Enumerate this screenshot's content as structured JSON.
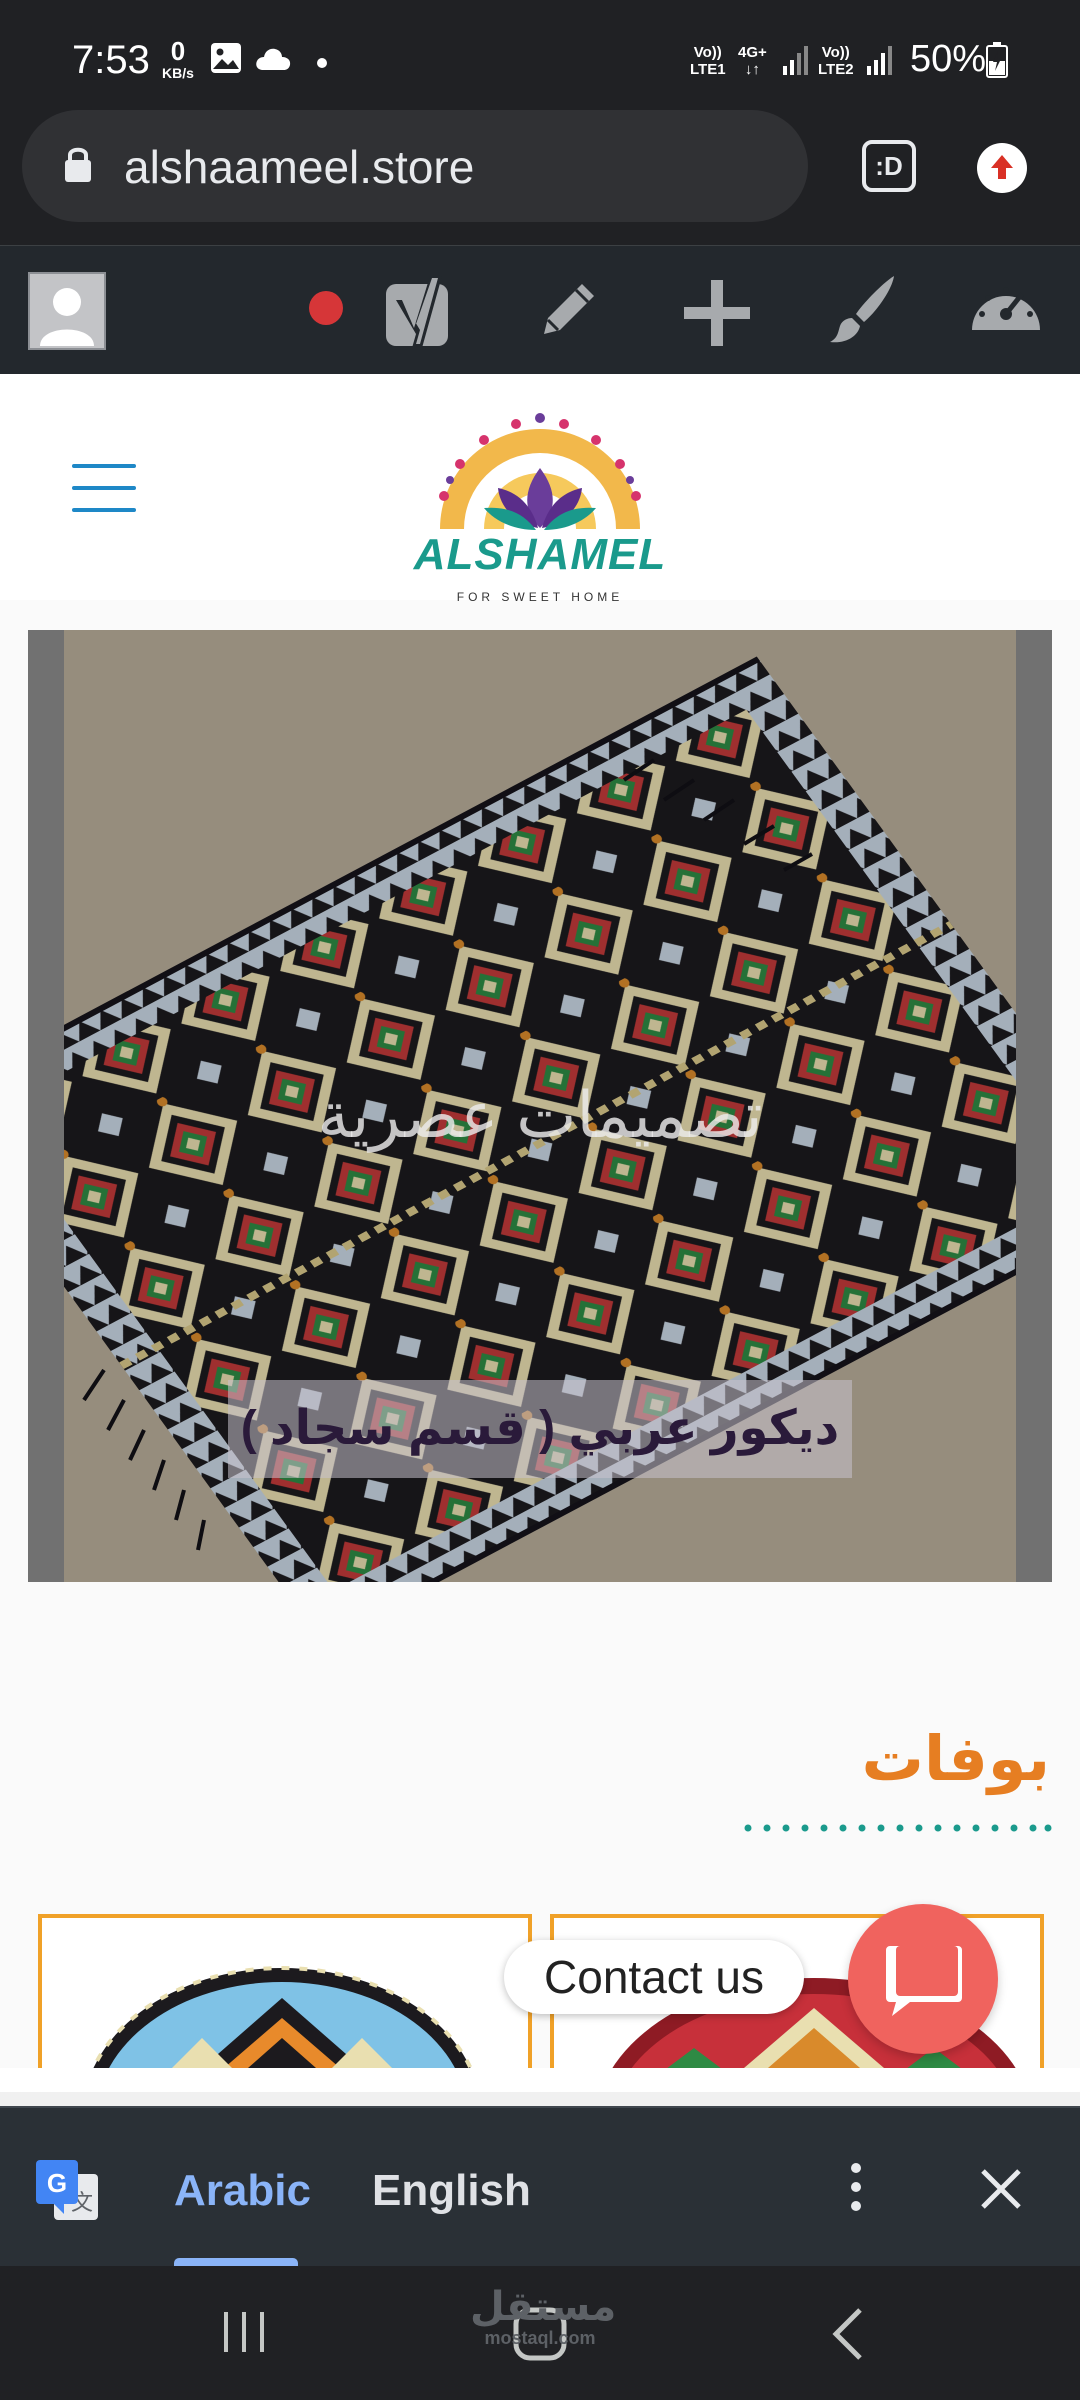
{
  "status_bar": {
    "time": "7:53",
    "net_speed_value": "0",
    "net_speed_unit": "KB/s",
    "sim1_top": "Vo))",
    "sim1_bottom": "LTE1",
    "net_type": "4G+",
    "sim2_top": "Vo))",
    "sim2_bottom": "LTE2",
    "battery": "50%",
    "icons": [
      "gallery-icon",
      "cloud-icon",
      "dot-icon",
      "signal-icon",
      "battery-icon"
    ]
  },
  "address_bar": {
    "url": "alshaameel.store",
    "tab_switcher": ":D"
  },
  "site": {
    "logo_text": "ALSHAMEL",
    "logo_subtext": "FOR SWEET HOME"
  },
  "slider": {
    "title": "تصميمات عصرية",
    "button_label": "ديكور عربي ( قسم سجاد )"
  },
  "section": {
    "title": "بوفات"
  },
  "contact": {
    "label": "Contact us"
  },
  "translate_bar": {
    "source_language": "Arabic",
    "target_language": "English"
  },
  "watermark": {
    "line1": "مستقل",
    "line2": "mostaql.com"
  },
  "colors": {
    "chrome_dark": "#202124",
    "admin_bar": "#23282d",
    "accent_orange": "#e67e22",
    "accent_teal": "#1a9a8c",
    "contact_red": "#f0635e",
    "translate_blue": "#8ab4f8"
  }
}
